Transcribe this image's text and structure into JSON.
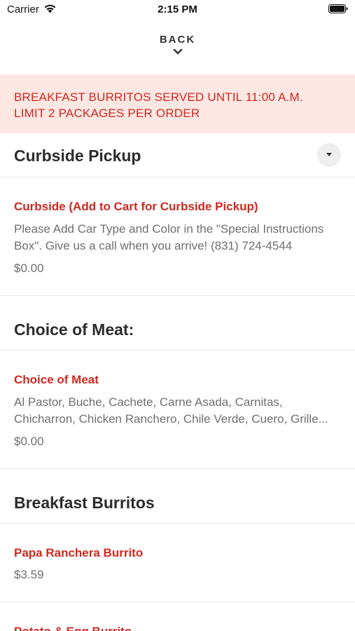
{
  "status_bar": {
    "carrier": "Carrier",
    "time": "2:15 PM"
  },
  "nav": {
    "back_label": "BACK"
  },
  "notice": {
    "line1": "BREAKFAST BURRITOS SERVED UNTIL 11:00 A.M.",
    "line2": "LIMIT 2 PACKAGES PER ORDER"
  },
  "sections": {
    "curbside": {
      "title": "Curbside Pickup",
      "item": {
        "name": "Curbside (Add to Cart for Curbside Pickup)",
        "desc_line1": "Please Add Car Type and Color in the \"Special Instructions",
        "desc_line2": "Box\". Give us a call when you arrive! (831) 724-4544",
        "price": "$0.00"
      }
    },
    "meat": {
      "title": "Choice of Meat:",
      "item": {
        "name": "Choice of Meat",
        "desc_line1": "Al Pastor, Buche, Cachete, Carne Asada, Carnitas,",
        "desc_line2": "Chicharron, Chicken Ranchero, Chile Verde, Cuero, Grille...",
        "price": "$0.00"
      }
    },
    "breakfast": {
      "title": "Breakfast Burritos",
      "items": [
        {
          "name": "Papa Ranchera Burrito",
          "price": "$3.59"
        },
        {
          "name": "Potato & Egg Burrito"
        }
      ]
    }
  },
  "colors": {
    "accent_red": "#d0281f",
    "notice_bg": "#fde7e3",
    "muted_text": "#6f6f6f",
    "divider": "#e8e8e8"
  }
}
